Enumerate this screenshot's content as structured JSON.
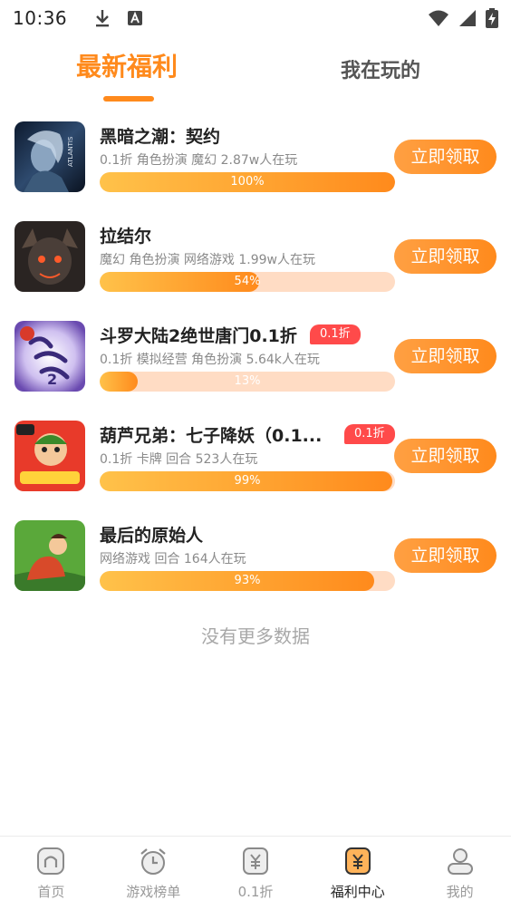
{
  "status_bar": {
    "time": "10:36"
  },
  "tabs": [
    {
      "label": "最新福利",
      "active": true
    },
    {
      "label": "我在玩的",
      "active": false
    }
  ],
  "games": [
    {
      "title": "黑暗之潮：契约",
      "badge": "",
      "meta": "0.1折 角色扮演 魔幻  2.87w人在玩",
      "progress": 100,
      "progress_label": "100%",
      "button": "立即领取",
      "icon": "dark-tide-icon"
    },
    {
      "title": "拉结尔",
      "badge": "",
      "meta": "魔幻 角色扮演 网络游戏  1.99w人在玩",
      "progress": 54,
      "progress_label": "54%",
      "button": "立即领取",
      "icon": "lajieer-icon"
    },
    {
      "title": "斗罗大陆2绝世唐门0.1折",
      "badge": "0.1折",
      "meta": "0.1折 模拟经营 角色扮演  5.64k人在玩",
      "progress": 13,
      "progress_label": "13%",
      "button": "立即领取",
      "icon": "douluo-icon"
    },
    {
      "title": "葫芦兄弟：七子降妖（0.1...",
      "badge": "0.1折",
      "meta": "0.1折 卡牌 回合  523人在玩",
      "progress": 99,
      "progress_label": "99%",
      "button": "立即领取",
      "icon": "huluxiongdi-icon"
    },
    {
      "title": "最后的原始人",
      "badge": "",
      "meta": "网络游戏 回合  164人在玩",
      "progress": 93,
      "progress_label": "93%",
      "button": "立即领取",
      "icon": "last-caveman-icon"
    }
  ],
  "no_more_text": "没有更多数据",
  "bottom_nav": [
    {
      "label": "首页",
      "icon": "home-icon",
      "active": false
    },
    {
      "label": "游戏榜单",
      "icon": "alarm-clock-icon",
      "active": false
    },
    {
      "label": "0.1折",
      "icon": "yen-card-icon",
      "active": false
    },
    {
      "label": "福利中心",
      "icon": "yen-card-filled-icon",
      "active": true
    },
    {
      "label": "我的",
      "icon": "user-icon",
      "active": false
    }
  ],
  "colors": {
    "accent": "#ff8a1c",
    "badge": "#ff4a4a",
    "progress_track": "#ffdcc4"
  }
}
